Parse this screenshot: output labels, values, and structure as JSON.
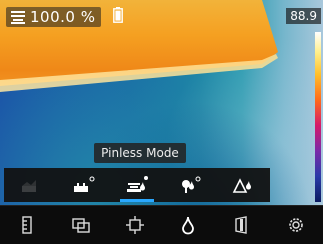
{
  "readout": {
    "value": "100.0 %",
    "icon": "pinless-moisture-icon"
  },
  "battery": {
    "icon": "battery-icon"
  },
  "scale": {
    "max_value": "88.9",
    "icon": "thermal-color-scale"
  },
  "mode": {
    "current_label": "Pinless Mode",
    "items": [
      {
        "name": "mode-wood-disabled",
        "icon": "wood-grain-icon",
        "selected": false
      },
      {
        "name": "mode-pin",
        "icon": "pin-mode-icon",
        "selected": false
      },
      {
        "name": "mode-pinless",
        "icon": "pinless-mode-icon",
        "selected": true
      },
      {
        "name": "mode-ambient",
        "icon": "ambient-mode-icon",
        "selected": false
      },
      {
        "name": "mode-relative",
        "icon": "relative-mode-icon",
        "selected": false
      }
    ]
  },
  "toolbar": {
    "items": [
      {
        "name": "scale-tool",
        "icon": "ruler-scale-icon"
      },
      {
        "name": "image-mode-tool",
        "icon": "picture-in-picture-icon"
      },
      {
        "name": "spot-tool",
        "icon": "crosshair-spot-icon"
      },
      {
        "name": "moisture-tool",
        "icon": "water-drop-icon"
      },
      {
        "name": "palette-tool",
        "icon": "palette-icon"
      },
      {
        "name": "settings-tool",
        "icon": "gear-icon"
      }
    ]
  },
  "colors": {
    "accent_selected": "#2aa8ff",
    "hot": "#f5a021",
    "cool": "#1c58a8"
  }
}
